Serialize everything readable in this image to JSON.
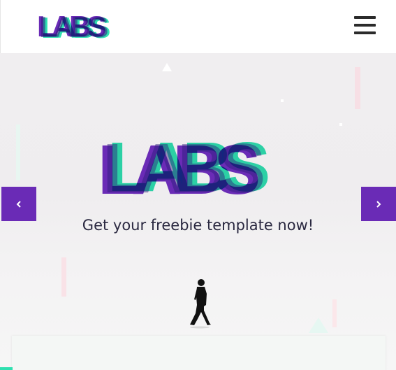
{
  "header": {
    "logo": "LABS",
    "menu_icon": "hamburger-menu-icon"
  },
  "hero": {
    "logo": "LABS",
    "tagline": "Get your freebie template now!",
    "prev_icon": "chevron-left-icon",
    "next_icon": "chevron-right-icon"
  },
  "colors": {
    "purple": "#6a2bb6",
    "teal": "#2fe0b0",
    "navy": "#2b1d7a"
  }
}
